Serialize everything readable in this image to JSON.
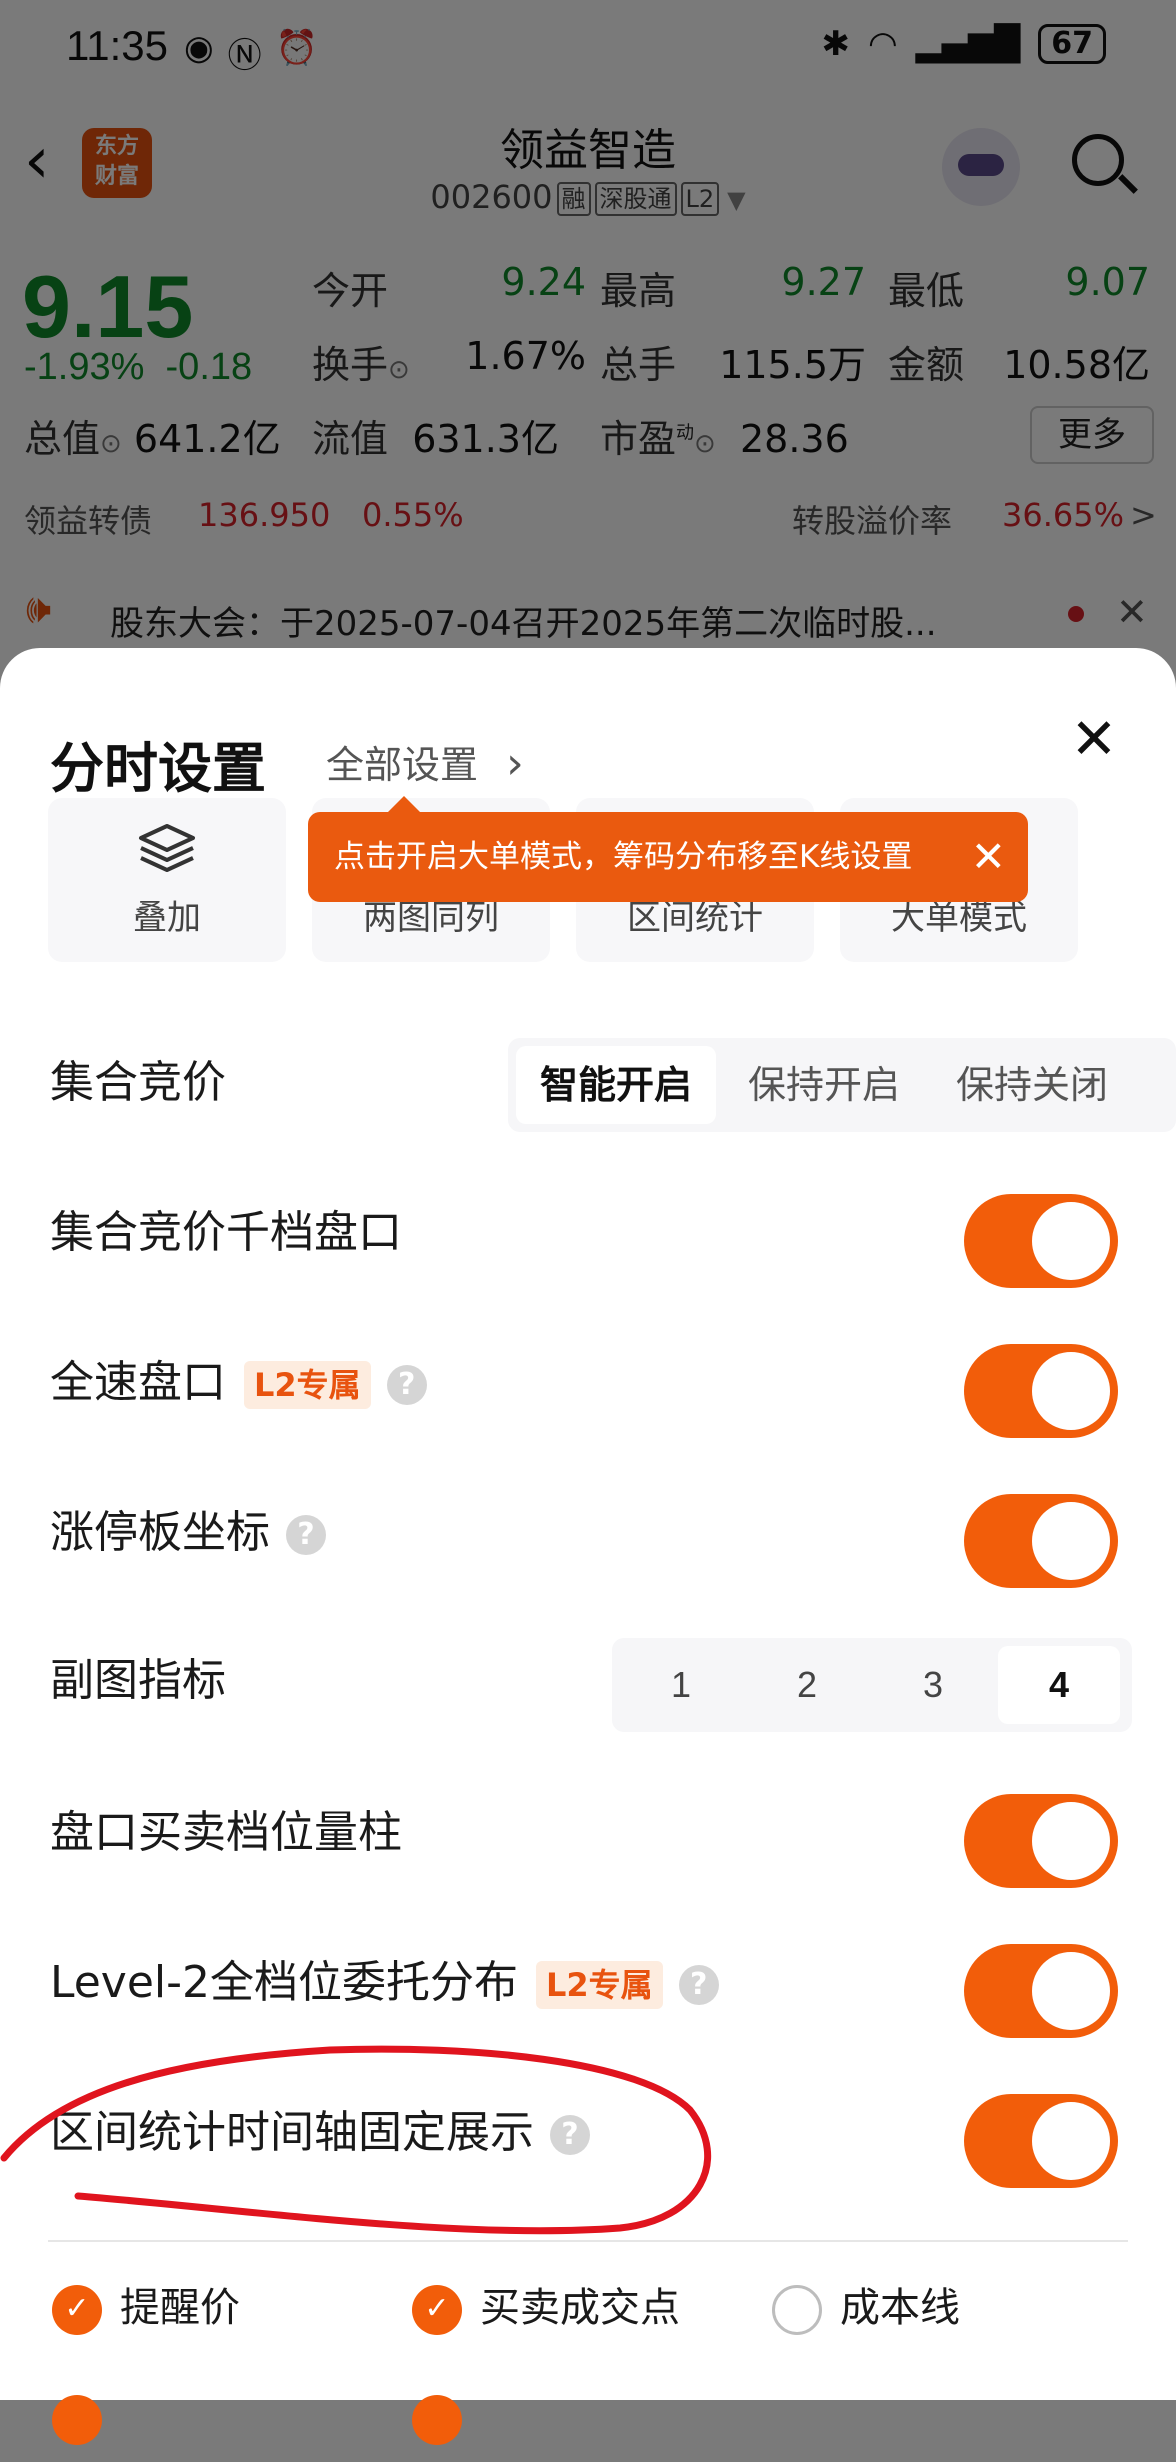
{
  "status_bar": {
    "time": "11:35",
    "battery": "67",
    "left_icons": [
      "eye-icon",
      "nfc-icon",
      "alarm-icon"
    ],
    "right_icons": [
      "bluetooth-icon",
      "wifi-icon",
      "signal-4g-icon"
    ]
  },
  "nav": {
    "logo_line1": "东方",
    "logo_line2": "财富",
    "stock_name": "领益智造",
    "stock_code": "002600",
    "badges": [
      "融",
      "深股通",
      "L2"
    ]
  },
  "quote": {
    "price": "9.15",
    "change_pct": "-1.93%",
    "change_abs": "-0.18",
    "rows": [
      [
        {
          "label": "今开",
          "value": "9.24",
          "green": true
        },
        {
          "label": "最高",
          "value": "9.27",
          "green": true
        },
        {
          "label": "最低",
          "value": "9.07",
          "green": true
        }
      ],
      [
        {
          "label": "换手",
          "value": "1.67%",
          "green": false
        },
        {
          "label": "总手",
          "value": "115.5万",
          "green": false
        },
        {
          "label": "金额",
          "value": "10.58亿",
          "green": false
        }
      ]
    ],
    "total_value_label": "总值",
    "total_value": "641.2亿",
    "float_label": "流值",
    "float_value": "631.3亿",
    "pe_label": "市盈",
    "pe_sup": "动",
    "pe_value": "28.36",
    "more_label": "更多"
  },
  "convertible": {
    "name": "领益转债",
    "price": "136.950",
    "pct": "0.55%",
    "premium_label": "转股溢价率",
    "premium_value": "36.65%",
    "arrow": ">"
  },
  "notice": {
    "text": "股东大会：于2025-07-04召开2025年第二次临时股...",
    "close": "✕"
  },
  "sheet": {
    "title": "分时设置",
    "all_settings": "全部设置",
    "all_settings_arrow": "›",
    "close": "✕",
    "tools": [
      {
        "label": "叠加",
        "icon": "layers-icon"
      },
      {
        "label": "两图同列",
        "icon": "dual-chart-icon"
      },
      {
        "label": "区间统计",
        "icon": "range-stats-icon"
      },
      {
        "label": "大单模式",
        "icon": "big-order-icon"
      }
    ],
    "tooltip": "点击开启大单模式，筹码分布移至K线设置",
    "tooltip_close": "✕",
    "auction": {
      "label": "集合竞价",
      "options": [
        "智能开启",
        "保持开启",
        "保持关闭"
      ],
      "selected": "智能开启"
    },
    "toggles": [
      {
        "label": "集合竞价千档盘口",
        "l2": "",
        "help": false,
        "on": true
      },
      {
        "label": "全速盘口",
        "l2": "L2专属",
        "help": true,
        "on": true
      },
      {
        "label": "涨停板坐标",
        "l2": "",
        "help": true,
        "on": true
      }
    ],
    "sub_chart": {
      "label": "副图指标",
      "options": [
        "1",
        "2",
        "3",
        "4"
      ],
      "selected": "4"
    },
    "toggles2": [
      {
        "label": "盘口买卖档位量柱",
        "l2": "",
        "help": false,
        "on": true
      },
      {
        "label": "Level-2全档位委托分布",
        "l2": "L2专属",
        "help": true,
        "on": true
      },
      {
        "label": "区间统计时间轴固定展示",
        "l2": "",
        "help": true,
        "on": true
      }
    ],
    "checks": [
      {
        "label": "提醒价",
        "checked": true
      },
      {
        "label": "买卖成交点",
        "checked": true
      },
      {
        "label": "成本线",
        "checked": false
      }
    ],
    "help_glyph": "?",
    "check_glyph": "✓"
  },
  "colors": {
    "accent": "#f25d0a",
    "down_green": "#108a2a",
    "up_red": "#d8232a",
    "annotation_red": "#e0141e"
  }
}
